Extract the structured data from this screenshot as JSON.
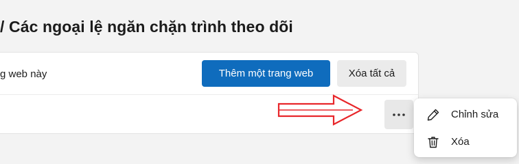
{
  "page": {
    "title": "/ Các ngoại lệ ngăn chặn trình theo dõi"
  },
  "header_row": {
    "label": "g web này",
    "add_button": "Thêm một trang web",
    "clear_all_button": "Xóa tất cả"
  },
  "row": {
    "more_button": "···",
    "more_icon": "more-horizontal-icon"
  },
  "context_menu": {
    "items": [
      {
        "label": "Chỉnh sửa",
        "icon": "pencil-icon"
      },
      {
        "label": "Xóa",
        "icon": "trash-icon"
      }
    ]
  },
  "annotation": {
    "arrow_icon": "red-arrow-icon",
    "arrow_color": "#e8262a"
  },
  "colors": {
    "accent": "#0f6cbd",
    "background": "#f3f3f3"
  }
}
